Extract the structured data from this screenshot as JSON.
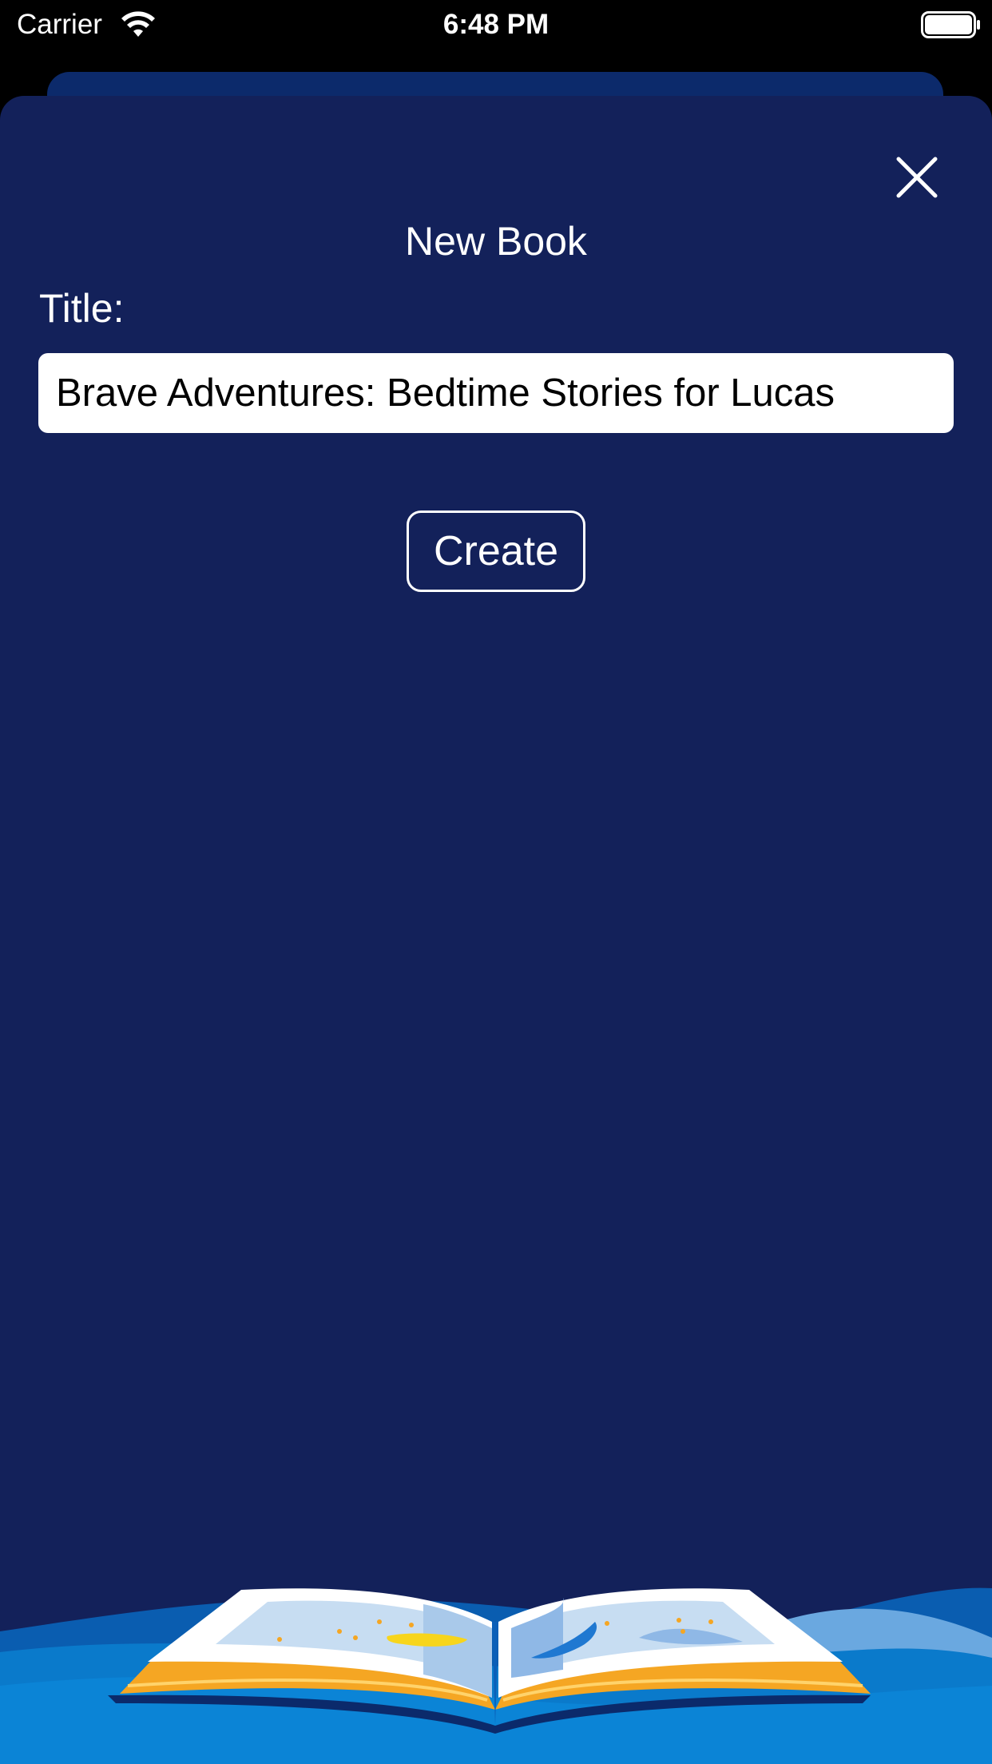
{
  "status_bar": {
    "carrier": "Carrier",
    "time": "6:48 PM"
  },
  "sheet": {
    "title": "New Book",
    "field_label": "Title:",
    "title_value": "Brave Adventures: Bedtime Stories for Lucas",
    "create_label": "Create"
  },
  "icons": {
    "wifi": "wifi-icon",
    "battery": "battery-icon",
    "close": "close-icon",
    "illustration": "open-book-illustration"
  },
  "colors": {
    "sheet_background": "#13215a",
    "back_card": "#0c2a6b",
    "wave": "#0a7acb",
    "book_edge": "#f5a623"
  }
}
